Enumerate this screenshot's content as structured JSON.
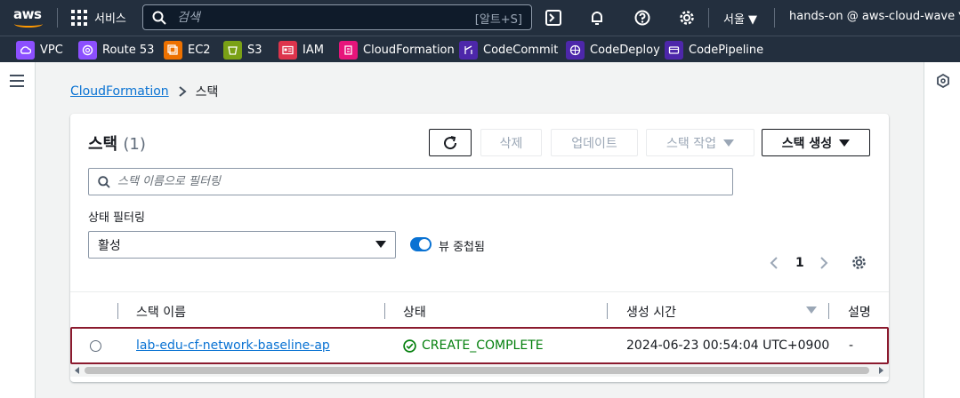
{
  "nav": {
    "logo": "aws",
    "services_label": "서비스",
    "search_placeholder": "검색",
    "search_shortcut": "[알트+S]",
    "region": "서울 ▼",
    "account": "hands-on @ aws-cloud-wave ▼"
  },
  "favorites": [
    {
      "label": "VPC",
      "color": "#8c4fff"
    },
    {
      "label": "Route 53",
      "color": "#8c4fff"
    },
    {
      "label": "EC2",
      "color": "#ed7100"
    },
    {
      "label": "S3",
      "color": "#7aa116"
    },
    {
      "label": "IAM",
      "color": "#dd344c"
    },
    {
      "label": "CloudFormation",
      "color": "#e7157b"
    },
    {
      "label": "CodeCommit",
      "color": "#4d27aa"
    },
    {
      "label": "CodeDeploy",
      "color": "#4d27aa"
    },
    {
      "label": "CodePipeline",
      "color": "#4d27aa"
    }
  ],
  "breadcrumb": {
    "root": "CloudFormation",
    "current": "스택"
  },
  "panel": {
    "title": "스택",
    "count": "(1)",
    "buttons": {
      "delete": "삭제",
      "update": "업데이트",
      "stack_actions": "스택 작업",
      "create_stack": "스택 생성"
    },
    "filter_placeholder": "스택 이름으로 필터링",
    "state_filter_label": "상태 필터링",
    "state_filter_value": "활성",
    "nested_toggle_label": "뷰 중첩됨",
    "page_number": "1"
  },
  "table": {
    "headers": {
      "name": "스택 이름",
      "status": "상태",
      "created": "생성 시간",
      "description": "설명"
    },
    "rows": [
      {
        "name": "lab-edu-cf-network-baseline-ap",
        "status": "CREATE_COMPLETE",
        "created": "2024-06-23 00:54:04 UTC+0900",
        "description": "-"
      }
    ]
  },
  "colors": {
    "nav_bg": "#232f3e",
    "link": "#0972d3",
    "success": "#037f0c",
    "selected_row_border": "#8b1a2e"
  }
}
